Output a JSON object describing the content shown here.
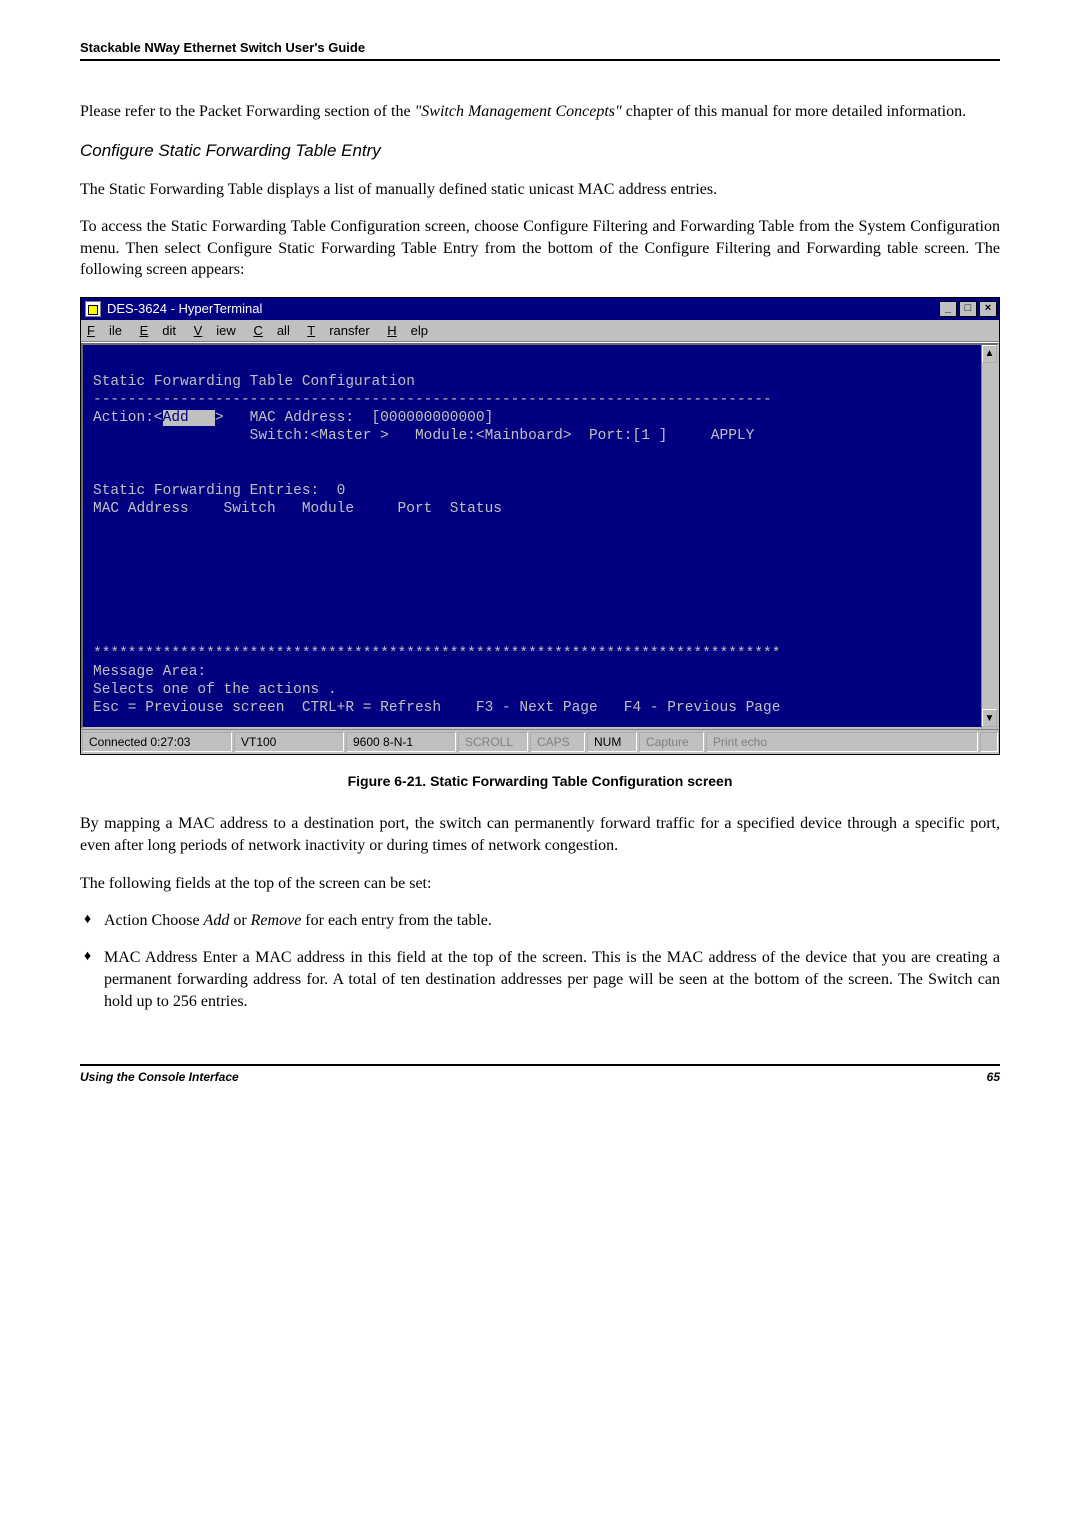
{
  "header": {
    "title": "Stackable NWay Ethernet Switch User's Guide"
  },
  "intro": {
    "p1a": "Please refer to the Packet Forwarding section of the ",
    "p1b": "\"Switch Management Concepts\"",
    "p1c": " chapter of this manual for more detailed information."
  },
  "section": {
    "heading": "Configure Static Forwarding Table Entry",
    "p1": "The Static Forwarding Table displays a list of manually defined static unicast MAC address entries.",
    "p2": "To access the Static Forwarding Table Configuration screen, choose Configure Filtering and Forwarding Table from the System Configuration menu. Then select Configure Static Forwarding Table Entry from the bottom of the Configure Filtering and Forwarding table screen. The following screen appears:"
  },
  "terminal": {
    "title": "DES-3624 - HyperTerminal",
    "menus": {
      "file": "File",
      "edit": "Edit",
      "view": "View",
      "call": "Call",
      "transfer": "Transfer",
      "help": "Help"
    },
    "winbtn": {
      "min": "_",
      "max": "□",
      "close": "×"
    },
    "scroll": {
      "up": "▲",
      "down": "▼"
    },
    "content": {
      "l1": "Static Forwarding Table Configuration",
      "l2": "------------------------------------------------------------------------------",
      "l3a": "Action:<",
      "l3h": "Add   ",
      "l3b": ">   MAC Address:  [000000000000]",
      "l4": "                  Switch:<Master >   Module:<Mainboard>  Port:[1 ]     APPLY",
      "l5": "Static Forwarding Entries:  0",
      "l6": "MAC Address    Switch   Module     Port  Status",
      "l7": "*******************************************************************************",
      "l8": "Message Area:",
      "l9": "Selects one of the actions .",
      "l10": "Esc = Previouse screen  CTRL+R = Refresh    F3 - Next Page   F4 - Previous Page"
    },
    "status": {
      "conn": "Connected 0:27:03",
      "emul": "VT100",
      "params": "9600 8-N-1",
      "scroll": "SCROLL",
      "caps": "CAPS",
      "num": "NUM",
      "capture": "Capture",
      "print": "Print echo"
    }
  },
  "figure": {
    "caption": "Figure 6-21.  Static Forwarding Table Configuration screen"
  },
  "after": {
    "p1": "By mapping a MAC address to a destination port, the switch can permanently forward traffic for a specified device through a specific port, even after long periods of network inactivity or during times of network congestion.",
    "p2": "The following fields at the top of the screen can be set:"
  },
  "bullets": {
    "b1a": "Action  Choose ",
    "b1b": "Add",
    "b1c": " or ",
    "b1d": "Remove",
    "b1e": " for each entry from the table.",
    "b2": "MAC Address  Enter a MAC address in this field at the top of the screen. This is the MAC address of the device that you are creating a permanent forwarding address for. A total of ten destination addresses per page will be seen at the bottom of the screen. The Switch can hold up to 256 entries."
  },
  "footer": {
    "left": "Using the Console Interface",
    "right": "65"
  }
}
